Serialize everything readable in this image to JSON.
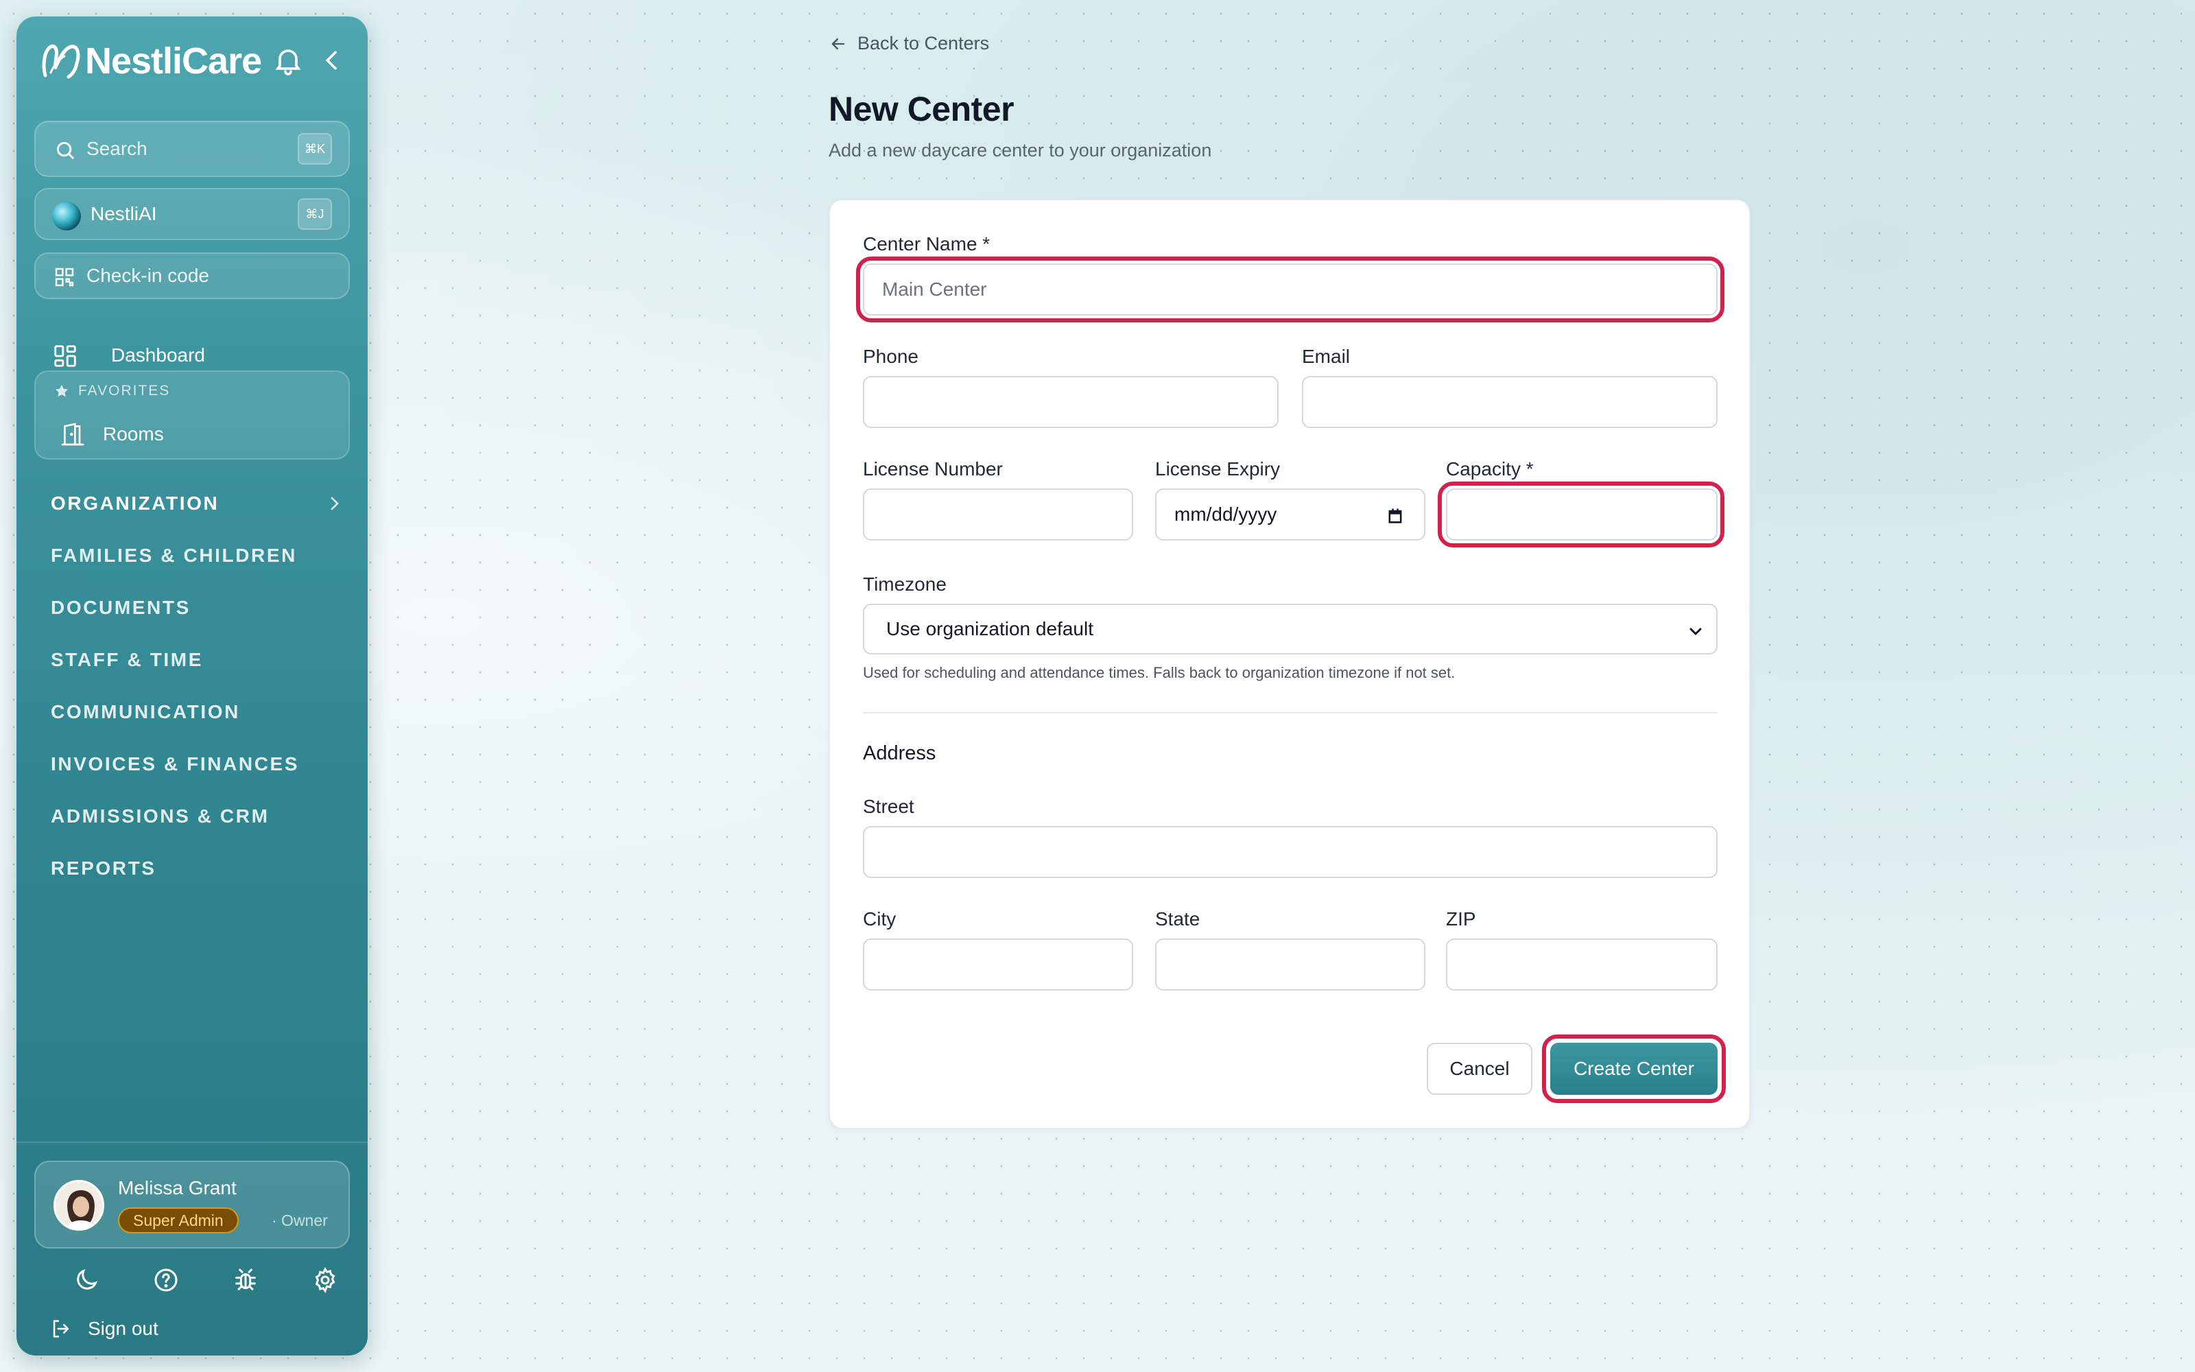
{
  "sidebar": {
    "brand": {
      "name": "NestliCare",
      "bell_icon": "bell-icon",
      "collapse_icon": "chevron-left-icon"
    },
    "search": {
      "label": "Search",
      "shortcut": "⌘K"
    },
    "ai": {
      "label": "NestliAI",
      "shortcut": "⌘J"
    },
    "checkin": {
      "label": "Check-in code"
    },
    "dashboard": {
      "label": "Dashboard"
    },
    "favorites": {
      "heading": "FAVORITES",
      "items": [
        {
          "label": "Rooms"
        }
      ]
    },
    "sections": [
      {
        "label": "ORGANIZATION"
      },
      {
        "label": "FAMILIES & CHILDREN"
      },
      {
        "label": "DOCUMENTS"
      },
      {
        "label": "STAFF & TIME"
      },
      {
        "label": "COMMUNICATION"
      },
      {
        "label": "INVOICES & FINANCES"
      },
      {
        "label": "ADMISSIONS & CRM"
      },
      {
        "label": "REPORTS"
      }
    ],
    "user": {
      "name": "Melissa Grant",
      "badge": "Super Admin",
      "role": "· Owner"
    },
    "signout": {
      "label": "Sign out"
    }
  },
  "main": {
    "back_link": "Back to Centers",
    "title": "New Center",
    "subtitle": "Add a new daycare center to your organization",
    "form": {
      "center_name": {
        "label": "Center Name *",
        "placeholder": "Main Center",
        "value": ""
      },
      "phone": {
        "label": "Phone",
        "value": ""
      },
      "email": {
        "label": "Email",
        "value": ""
      },
      "license_number": {
        "label": "License Number",
        "value": ""
      },
      "license_expiry": {
        "label": "License Expiry",
        "placeholder": "mm/dd/yyyy"
      },
      "capacity": {
        "label": "Capacity *",
        "value": ""
      },
      "timezone": {
        "label": "Timezone",
        "selected": "Use organization default",
        "hint": "Used for scheduling and attendance times. Falls back to organization timezone if not set."
      },
      "address": {
        "heading": "Address",
        "street": {
          "label": "Street",
          "value": ""
        },
        "city": {
          "label": "City",
          "value": ""
        },
        "state": {
          "label": "State",
          "value": ""
        },
        "zip": {
          "label": "ZIP",
          "value": ""
        }
      },
      "cancel_label": "Cancel",
      "submit_label": "Create Center"
    }
  },
  "colors": {
    "accent": "#2f8590",
    "highlight": "#d3214e",
    "badge_bg": "#7a4d05",
    "badge_border": "#d79a18"
  }
}
